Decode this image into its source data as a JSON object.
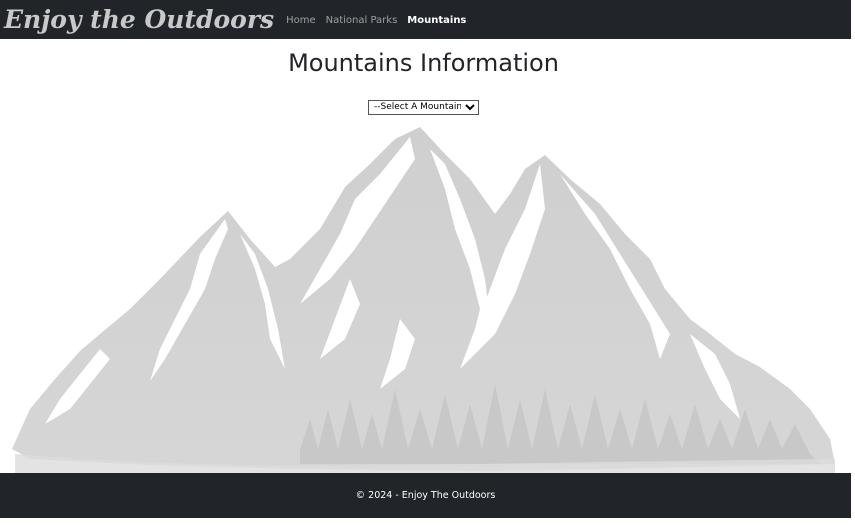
{
  "navbar": {
    "brand": "Enjoy the Outdoors",
    "links": [
      {
        "label": "Home",
        "active": false
      },
      {
        "label": "National Parks",
        "active": false
      },
      {
        "label": "Mountains",
        "active": true
      }
    ]
  },
  "main": {
    "title": "Mountains Information",
    "mountain_select": {
      "selected": "--Select A Mountain--"
    },
    "background_image": "mountain-range-illustration"
  },
  "footer": {
    "text": "© 2024 - Enjoy The Outdoors"
  },
  "colors": {
    "navbar_bg": "#212529",
    "brand_text": "#c9c9c9",
    "mountain_fill": "#d2d2d2"
  }
}
